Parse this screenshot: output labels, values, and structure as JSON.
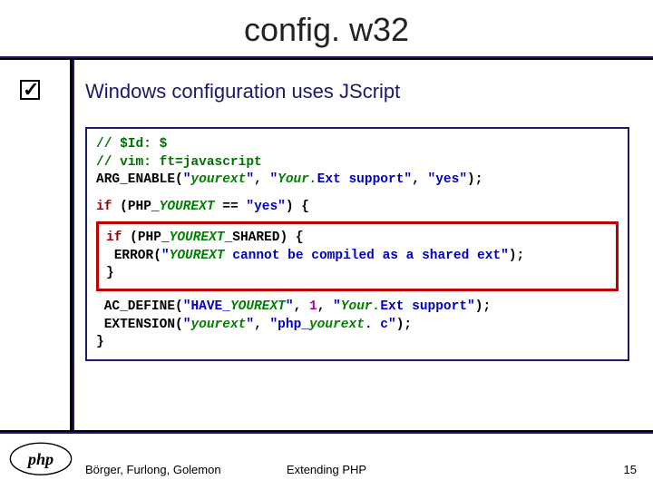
{
  "title": "config. w32",
  "bullet": "Windows configuration uses JScript",
  "code": {
    "line1_comment": "// $Id: $",
    "line2_comment": "// vim: ft=javascript",
    "arg_enable_fn": "ARG_ENABLE",
    "arg_enable_p1": "yourext",
    "arg_enable_p2a": "Your.",
    "arg_enable_p2b": "Ext",
    "arg_enable_p2c": " support",
    "arg_enable_p3": "yes",
    "if_prefix": "if",
    "php_const": "PHP_",
    "yourext_const": "YOUREXT",
    "eq": " == ",
    "yes_str": "yes",
    "open_brace": ") {",
    "inner_if": "if",
    "inner_php": "PHP_",
    "inner_yourext": "YOUREXT",
    "inner_shared": "_SHARED) {",
    "error_fn": "ERROR",
    "error_str_a": "YOUREXT",
    "error_str_b": " cannot be compiled as a shared ext",
    "inner_close": "}",
    "ac_define_fn": "AC_DEFINE",
    "ac_define_p1a": "HAVE_",
    "ac_define_p1b": "YOUREXT",
    "ac_define_num": "1",
    "ac_define_p3a": "Your.",
    "ac_define_p3b": "Ext",
    "ac_define_p3c": " support",
    "extension_fn": "EXTENSION",
    "extension_p1": "yourext",
    "extension_p2a": "php_",
    "extension_p2b": "yourext",
    "extension_p2c": ". c",
    "close_brace": "}"
  },
  "footer": {
    "authors": "Börger, Furlong, Golemon",
    "center": "Extending PHP",
    "page": "15"
  },
  "logo_text": "php"
}
